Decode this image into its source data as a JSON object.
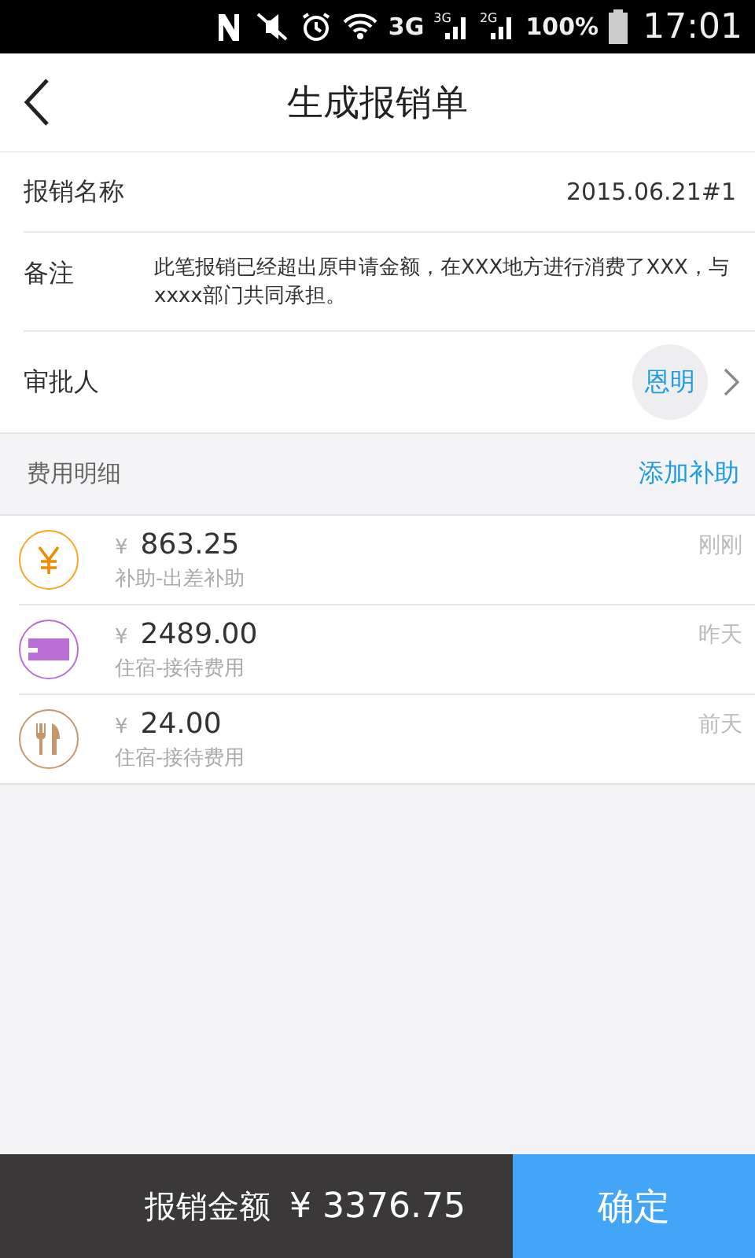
{
  "status_bar": {
    "network": "3G",
    "signals": [
      "3G",
      "2G"
    ],
    "battery": "100%",
    "time": "17:01"
  },
  "header": {
    "title": "生成报销单"
  },
  "fields": [
    {
      "label": "报销名称",
      "value": "2015.06.21#1",
      "kind": "text"
    },
    {
      "label": "备注",
      "value": "此笔报销已经超出原申请金额，在XXX地方进行消费了XXX，与xxxx部门共同承担。",
      "kind": "note"
    },
    {
      "label": "审批人",
      "value": "恩明",
      "kind": "person"
    }
  ],
  "section": {
    "title": "费用明细",
    "action": "添加补助"
  },
  "expenses": [
    {
      "kind": "yen",
      "color": "#f5a623",
      "currency": "¥",
      "amount": "863.25",
      "category": "补助-出差补助",
      "time": "刚刚"
    },
    {
      "kind": "card",
      "color": "#b96fd6",
      "currency": "¥",
      "amount": "2489.00",
      "category": "住宿-接待费用",
      "time": "昨天"
    },
    {
      "kind": "food",
      "color": "#c6976a",
      "currency": "¥",
      "amount": "24.00",
      "category": "住宿-接待费用",
      "time": "前天"
    }
  ],
  "footer": {
    "label": "报销金额",
    "total": "¥ 3376.75",
    "confirm": "确定"
  }
}
